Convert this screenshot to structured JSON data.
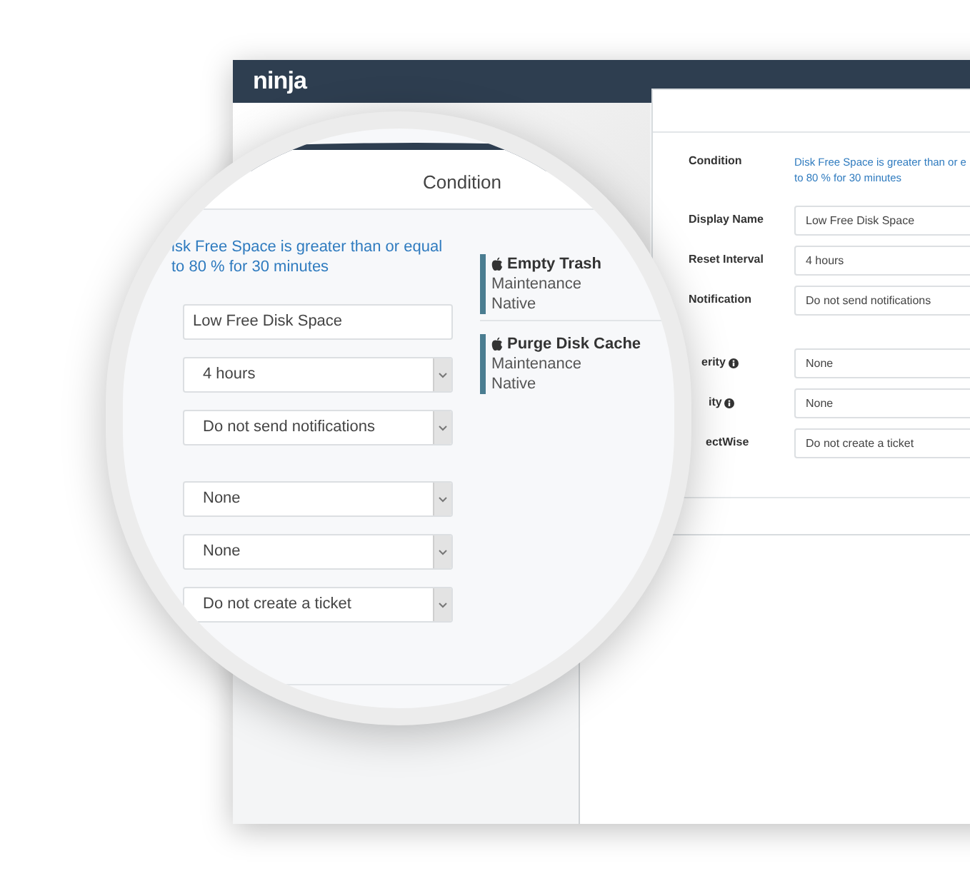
{
  "app": {
    "logo": "ninja"
  },
  "magnifier": {
    "title": "Condition",
    "condition_lines": [
      "isk Free Space is greater than or equal",
      "to 80 % for 30 minutes"
    ],
    "fields": [
      {
        "kind": "text",
        "value": "Low Free Disk Space"
      },
      {
        "kind": "select",
        "value": "4 hours"
      },
      {
        "kind": "select",
        "value": "Do not send notifications"
      }
    ],
    "more_fields": [
      {
        "kind": "select",
        "value": "None"
      },
      {
        "kind": "select",
        "value": "None"
      },
      {
        "kind": "select",
        "value": "Do not create a ticket"
      }
    ],
    "tasks": [
      {
        "name": "Empty Trash",
        "category": "Maintenance",
        "type": "Native"
      },
      {
        "name": "Purge Disk Cache",
        "category": "Maintenance",
        "type": "Native"
      }
    ]
  },
  "modal": {
    "rows": [
      {
        "kind": "text",
        "label": "Condition",
        "lines": [
          "Disk Free Space is greater than or e",
          "to 80 % for 30 minutes"
        ]
      },
      {
        "kind": "field",
        "label": "Display Name",
        "value": "Low Free Disk Space"
      },
      {
        "kind": "field",
        "label": "Reset Interval",
        "value": "4 hours"
      },
      {
        "kind": "field",
        "label": "Notification",
        "value": "Do not send notifications"
      }
    ],
    "more_rows": [
      {
        "kind": "field",
        "label": "erity",
        "info": true,
        "value": "None"
      },
      {
        "kind": "field",
        "label": "ity",
        "info": true,
        "value": "None"
      },
      {
        "kind": "field",
        "label": "ectWise",
        "info": false,
        "value": "Do not create a ticket"
      }
    ]
  }
}
